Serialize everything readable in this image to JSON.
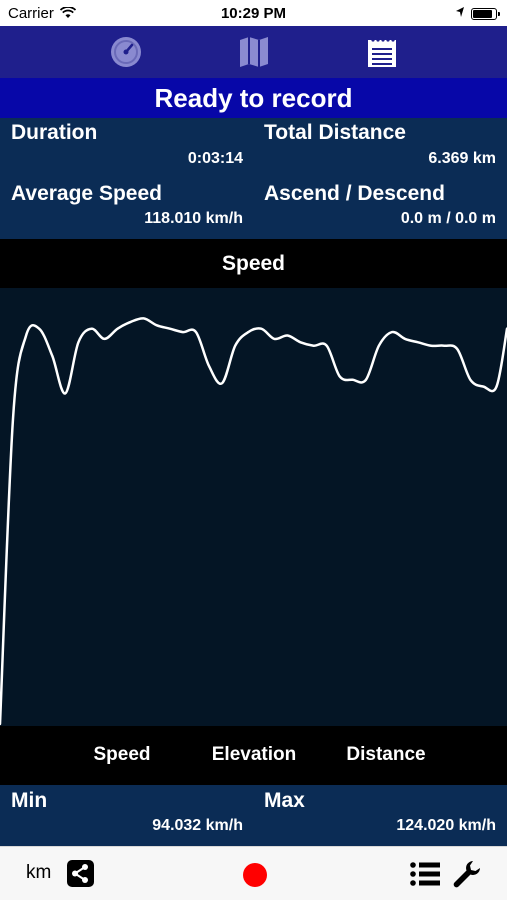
{
  "status_bar": {
    "carrier": "Carrier",
    "time": "10:29 PM"
  },
  "tabs": [
    "speedometer-icon",
    "map-icon",
    "notepad-icon"
  ],
  "banner": "Ready to record",
  "stats": {
    "duration_label": "Duration",
    "duration_value": "0:03:14",
    "distance_label": "Total Distance",
    "distance_value": "6.369 km",
    "avg_speed_label": "Average Speed",
    "avg_speed_value": "118.010 km/h",
    "ascend_label": "Ascend / Descend",
    "ascend_value": "0.0 m / 0.0 m"
  },
  "chart_header": "Speed",
  "chart_data": {
    "type": "line",
    "x": [
      0,
      5,
      10,
      15,
      20,
      25,
      30,
      35,
      40,
      45,
      50,
      55,
      60,
      65,
      70,
      75,
      80,
      85,
      90,
      95,
      100,
      105,
      110,
      115,
      120,
      125,
      130,
      135,
      140,
      145,
      150,
      155,
      160,
      165,
      170,
      175,
      180,
      185,
      190,
      194
    ],
    "series": [
      {
        "values": [
          0,
          90,
          114,
          116,
          108,
          97,
          112,
          116,
          113,
          116,
          118,
          119,
          117,
          116,
          115,
          115,
          105,
          100,
          111,
          115,
          116,
          113,
          114,
          112,
          111,
          111,
          102,
          101,
          101,
          111,
          115,
          113,
          112,
          111,
          111,
          110,
          101,
          99,
          99,
          116
        ]
      }
    ],
    "ylim": [
      0,
      125
    ],
    "grid": false,
    "color": "#ffffff"
  },
  "chart_tabs": [
    "Speed",
    "Elevation",
    "Distance"
  ],
  "minmax": {
    "min_label": "Min",
    "min_value": "94.032 km/h",
    "max_label": "Max",
    "max_value": "124.020 km/h"
  },
  "toolbar": {
    "unit": "km"
  }
}
